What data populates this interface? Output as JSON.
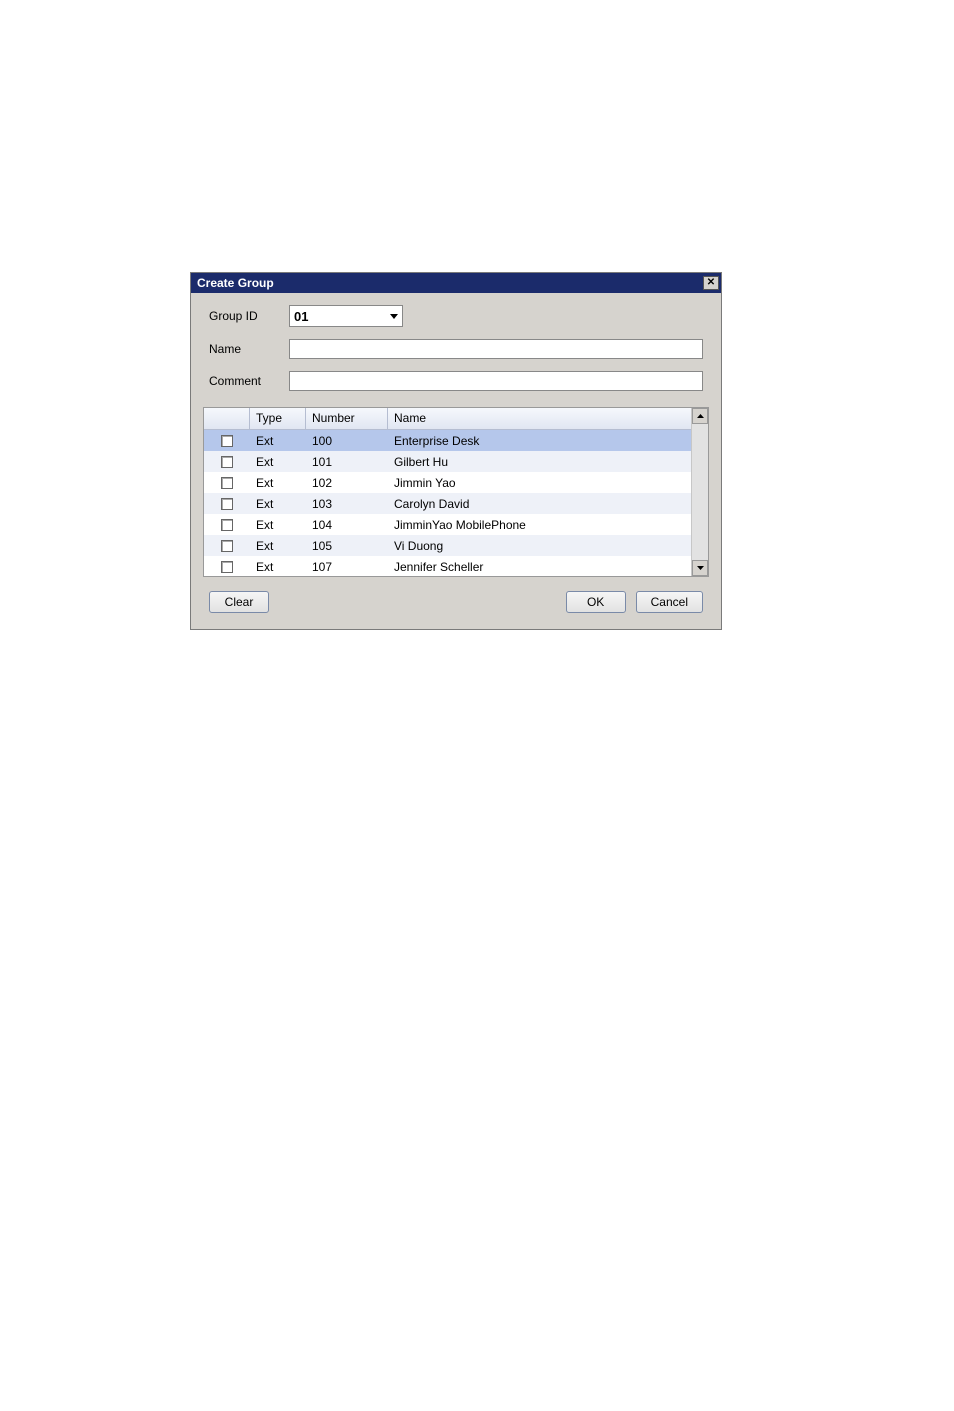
{
  "dialog": {
    "title": "Create Group",
    "close_icon": "close-icon"
  },
  "form": {
    "group_id_label": "Group ID",
    "group_id_value": "01",
    "name_label": "Name",
    "name_value": "",
    "comment_label": "Comment",
    "comment_value": ""
  },
  "table": {
    "headers": {
      "check": "",
      "type": "Type",
      "number": "Number",
      "name": "Name"
    },
    "rows": [
      {
        "checked": false,
        "type": "Ext",
        "number": "100",
        "name": "Enterprise Desk",
        "selected": true
      },
      {
        "checked": false,
        "type": "Ext",
        "number": "101",
        "name": "Gilbert Hu",
        "selected": false
      },
      {
        "checked": false,
        "type": "Ext",
        "number": "102",
        "name": "Jimmin Yao",
        "selected": false
      },
      {
        "checked": false,
        "type": "Ext",
        "number": "103",
        "name": "Carolyn David",
        "selected": false
      },
      {
        "checked": false,
        "type": "Ext",
        "number": "104",
        "name": "JimminYao MobilePhone",
        "selected": false
      },
      {
        "checked": false,
        "type": "Ext",
        "number": "105",
        "name": "Vi Duong",
        "selected": false
      },
      {
        "checked": false,
        "type": "Ext",
        "number": "107",
        "name": "Jennifer Scheller",
        "selected": false
      }
    ]
  },
  "buttons": {
    "clear": "Clear",
    "ok": "OK",
    "cancel": "Cancel"
  }
}
